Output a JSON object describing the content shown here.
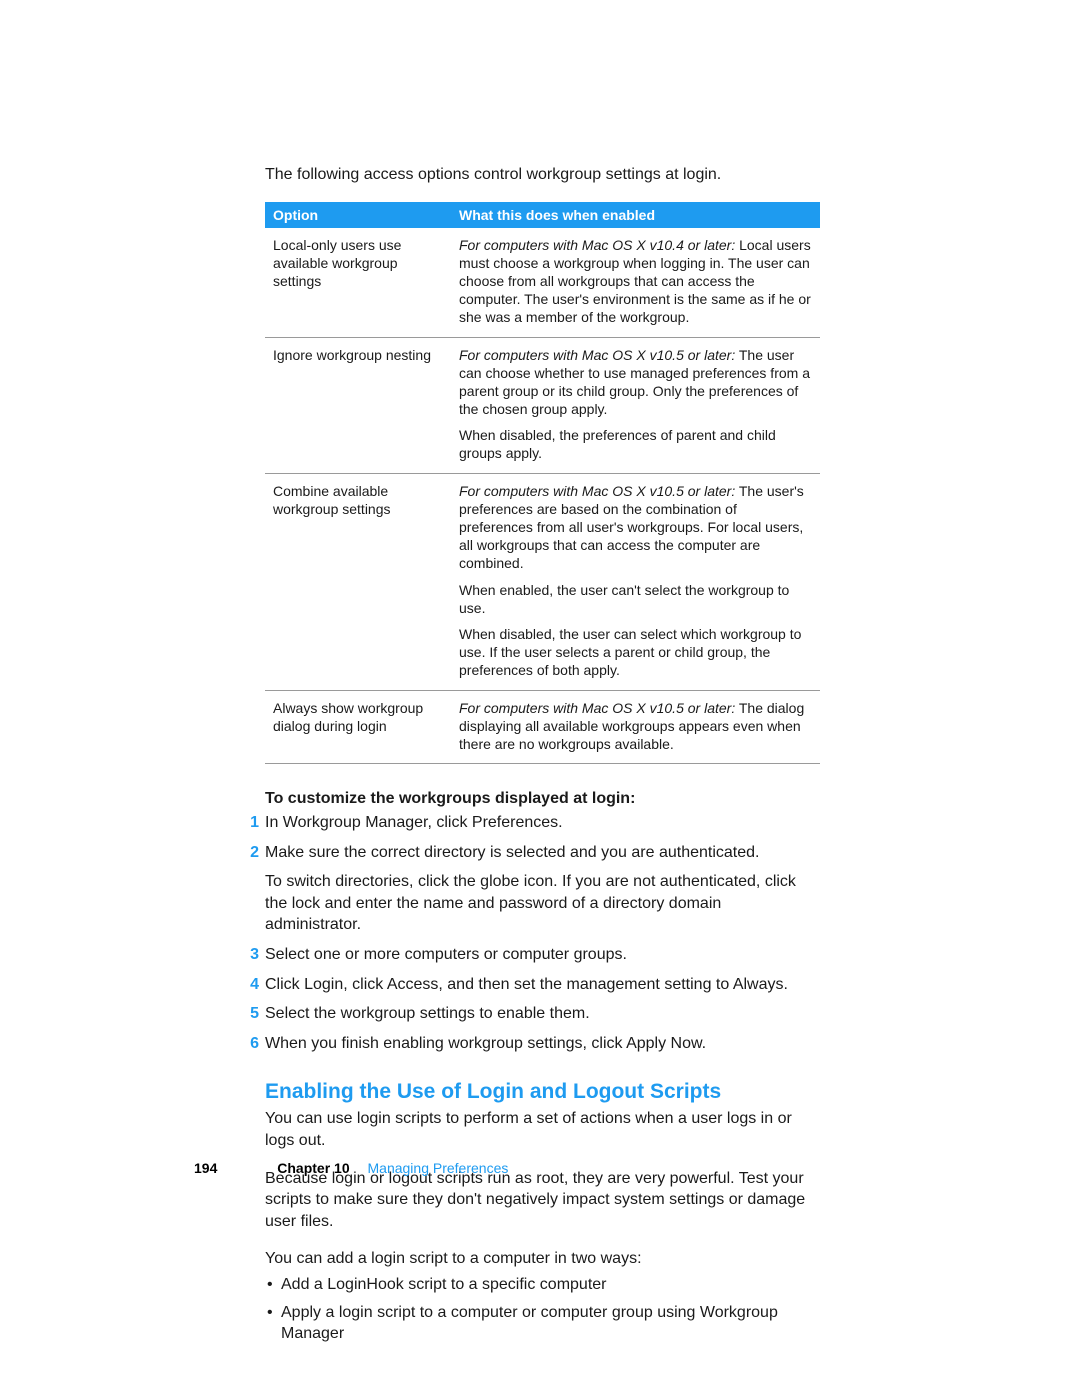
{
  "intro": "The following access options control workgroup settings at login.",
  "table_headers": {
    "option": "Option",
    "desc": "What this does when enabled"
  },
  "table_rows": [
    {
      "option": "Local-only users use available workgroup settings",
      "lead": "For computers with Mac OS X v10.4 or later:",
      "rest": " Local users must choose a workgroup when logging in. The user can choose from all workgroups that can access the computer. The user's environment is the same as if he or she was a member of the workgroup.",
      "extras": []
    },
    {
      "option": "Ignore workgroup nesting",
      "lead": "For computers with Mac OS X v10.5 or later:",
      "rest": " The user can choose whether to use managed preferences from a parent group or its child group. Only the preferences of the chosen group apply.",
      "extras": [
        "When disabled, the preferences of parent and child groups apply."
      ]
    },
    {
      "option": "Combine available workgroup settings",
      "lead": "For computers with Mac OS X v10.5 or later:",
      "rest": " The user's preferences are based on the combination of preferences from all user's workgroups. For local users, all workgroups that can access the computer are combined.",
      "extras": [
        "When enabled, the user can't select the workgroup to use.",
        "When disabled, the user can select which workgroup to use. If the user selects a parent or child group, the preferences of both apply."
      ]
    },
    {
      "option": "Always show workgroup dialog during login",
      "lead": "For computers with Mac OS X v10.5 or later:",
      "rest": " The dialog displaying all available workgroups appears even when there are no workgroups available.",
      "extras": []
    }
  ],
  "subhead": "To customize the workgroups displayed at login:",
  "steps": [
    {
      "text": "In Workgroup Manager, click Preferences."
    },
    {
      "text": "Make sure the correct directory is selected and you are authenticated.",
      "sub": "To switch directories, click the globe icon. If you are not authenticated, click the lock and enter the name and password of a directory domain administrator."
    },
    {
      "text": "Select one or more computers or computer groups."
    },
    {
      "text": "Click Login, click Access, and then set the management setting to Always."
    },
    {
      "text": "Select the workgroup settings to enable them."
    },
    {
      "text": "When you finish enabling workgroup settings, click Apply Now."
    }
  ],
  "section_heading": "Enabling the Use of Login and Logout Scripts",
  "section_paras": [
    "You can use login scripts to perform a set of actions when a user logs in or logs out.",
    "Because login or logout scripts run as root, they are very powerful. Test your scripts to make sure they don't negatively impact system settings or damage user files.",
    "You can add a login script to a computer in two ways:"
  ],
  "bullets": [
    "Add a LoginHook script to a specific computer",
    "Apply a login script to a computer or computer group using Workgroup Manager"
  ],
  "footer": {
    "page_number": "194",
    "chapter_label": "Chapter 10",
    "chapter_title": "Managing Preferences"
  }
}
